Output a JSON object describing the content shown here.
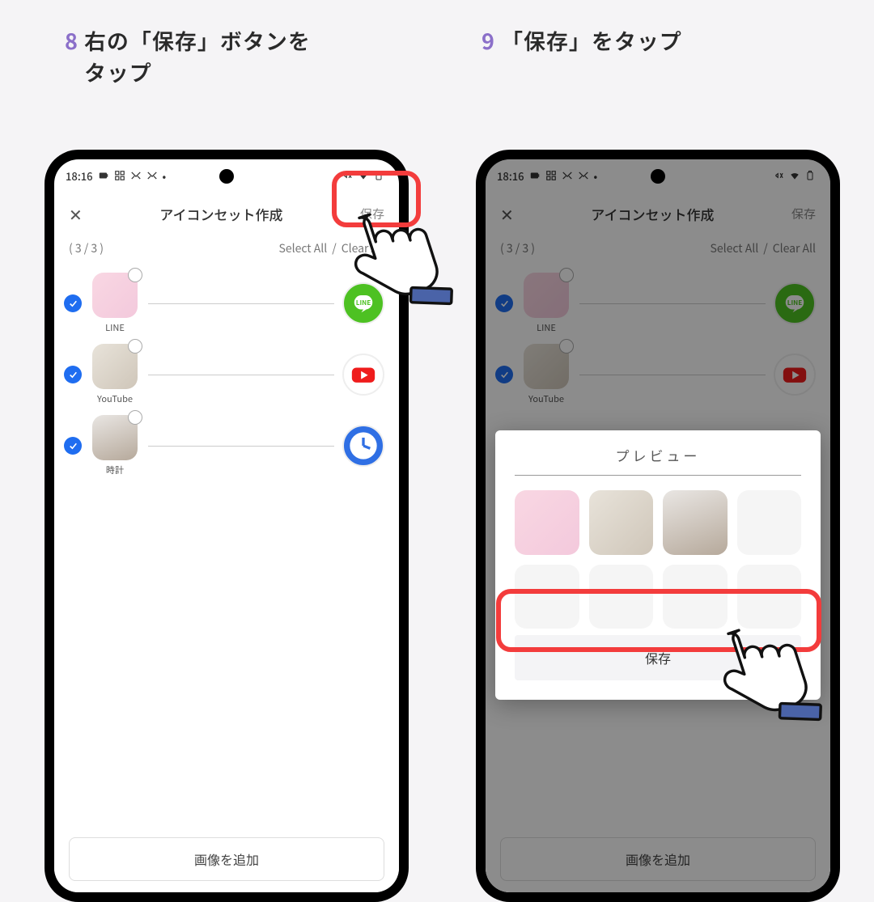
{
  "steps": {
    "s8": {
      "num": "8",
      "text": "右の「保存」ボタンを\nタップ"
    },
    "s9": {
      "num": "9",
      "text": "「保存」をタップ"
    }
  },
  "statusbar": {
    "time": "18:16"
  },
  "screen": {
    "title": "アイコンセット作成",
    "save": "保存",
    "counter": "( 3 / 3 )",
    "select_all": "Select All",
    "clear_all": "Clear All",
    "sep": "/",
    "rows": [
      {
        "label": "LINE"
      },
      {
        "label": "YouTube"
      },
      {
        "label": "時計"
      }
    ],
    "add_image": "画像を追加"
  },
  "dialog": {
    "title": "プレビュー",
    "save": "保存"
  }
}
